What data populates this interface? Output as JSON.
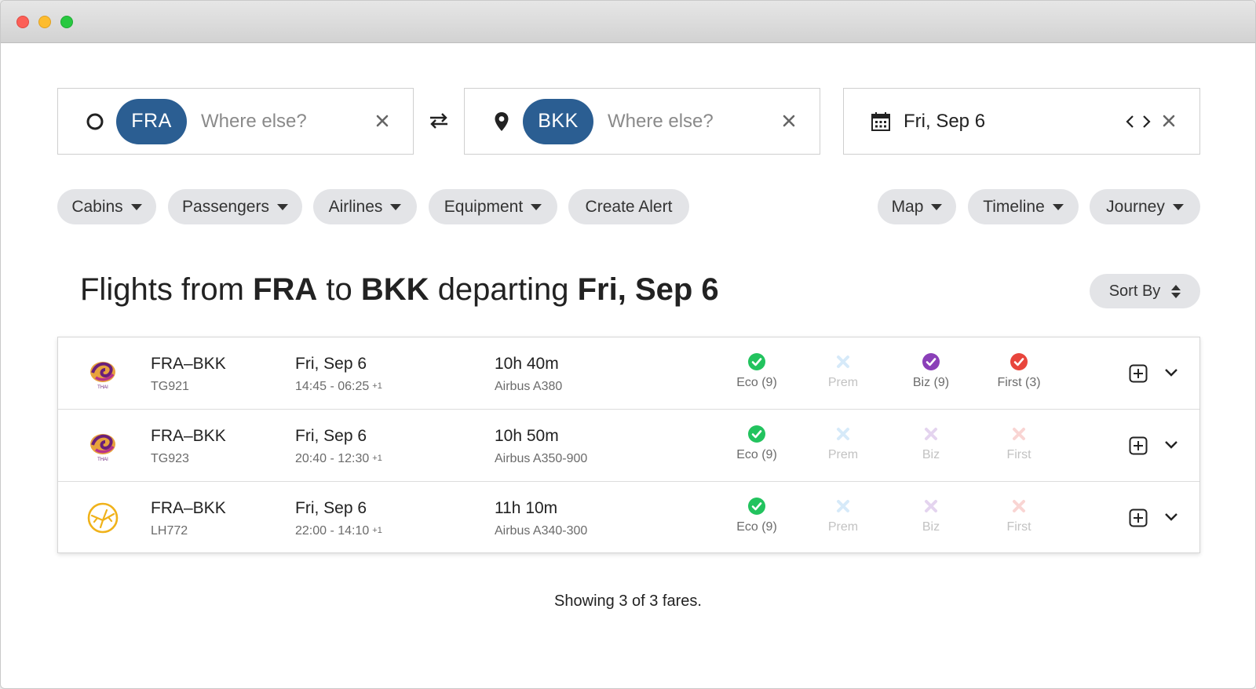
{
  "search": {
    "origin": {
      "code": "FRA",
      "placeholder": "Where else?"
    },
    "destination": {
      "code": "BKK",
      "placeholder": "Where else?"
    },
    "date": {
      "label": "Fri, Sep 6"
    }
  },
  "filters": {
    "cabins": "Cabins",
    "passengers": "Passengers",
    "airlines": "Airlines",
    "equipment": "Equipment",
    "create_alert": "Create Alert",
    "map": "Map",
    "timeline": "Timeline",
    "journey": "Journey"
  },
  "heading": {
    "prefix": "Flights from",
    "origin": "FRA",
    "to": "to",
    "destination": "BKK",
    "departing": "departing",
    "date": "Fri, Sep 6"
  },
  "sort": {
    "label": "Sort By"
  },
  "colors": {
    "chip": "#2b5e92",
    "eco": "#22c35e",
    "prem": "#4aa3e8",
    "biz": "#8a3fb8",
    "first": "#e8453c"
  },
  "flights": [
    {
      "airline_icon": "thai-airways-logo",
      "route": "FRA–BKK",
      "flight_no": "TG921",
      "date": "Fri, Sep 6",
      "times": "14:45 - 06:25",
      "day_offset": "+1",
      "duration": "10h 40m",
      "aircraft": "Airbus A380",
      "cabins": [
        {
          "label": "Eco (9)",
          "available": true,
          "kind": "eco"
        },
        {
          "label": "Prem",
          "available": false,
          "kind": "prem"
        },
        {
          "label": "Biz (9)",
          "available": true,
          "kind": "biz"
        },
        {
          "label": "First (3)",
          "available": true,
          "kind": "first"
        }
      ]
    },
    {
      "airline_icon": "thai-airways-logo",
      "route": "FRA–BKK",
      "flight_no": "TG923",
      "date": "Fri, Sep 6",
      "times": "20:40 - 12:30",
      "day_offset": "+1",
      "duration": "10h 50m",
      "aircraft": "Airbus A350-900",
      "cabins": [
        {
          "label": "Eco (9)",
          "available": true,
          "kind": "eco"
        },
        {
          "label": "Prem",
          "available": false,
          "kind": "prem"
        },
        {
          "label": "Biz",
          "available": false,
          "kind": "biz"
        },
        {
          "label": "First",
          "available": false,
          "kind": "first"
        }
      ]
    },
    {
      "airline_icon": "lufthansa-logo",
      "route": "FRA–BKK",
      "flight_no": "LH772",
      "date": "Fri, Sep 6",
      "times": "22:00 - 14:10",
      "day_offset": "+1",
      "duration": "11h 10m",
      "aircraft": "Airbus A340-300",
      "cabins": [
        {
          "label": "Eco (9)",
          "available": true,
          "kind": "eco"
        },
        {
          "label": "Prem",
          "available": false,
          "kind": "prem"
        },
        {
          "label": "Biz",
          "available": false,
          "kind": "biz"
        },
        {
          "label": "First",
          "available": false,
          "kind": "first"
        }
      ]
    }
  ],
  "footer": {
    "summary": "Showing 3 of 3 fares."
  }
}
